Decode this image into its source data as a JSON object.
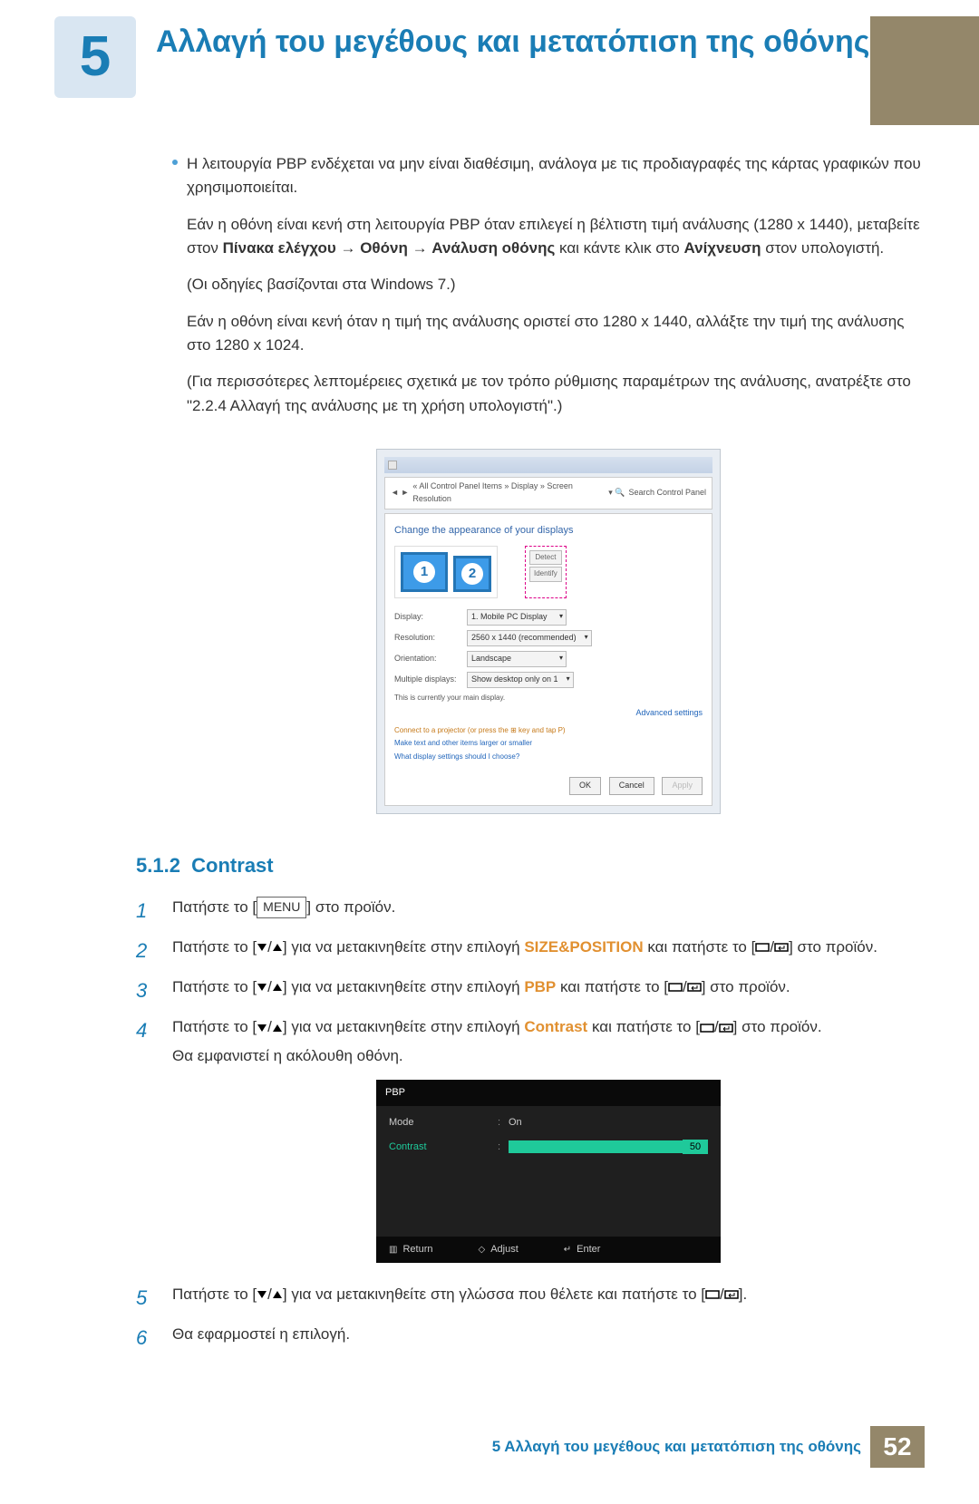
{
  "chapter": {
    "number": "5",
    "title": "Αλλαγή του μεγέθους και μετατόπιση της οθόνης"
  },
  "intro": {
    "bullet": "Η λειτουργία PBP ενδέχεται να μην είναι διαθέσιμη, ανάλογα με τις προδιαγραφές της κάρτας γραφικών που χρησιμοποιείται.",
    "p1_a": "Εάν η οθόνη είναι κενή στη λειτουργία PBP όταν επιλεγεί η βέλτιστη τιμή ανάλυσης (1280 x 1440), μεταβείτε στον ",
    "p1_b": "Πίνακα ελέγχου",
    "p1_c": "Οθόνη",
    "p1_d": "Ανάλυση οθόνης",
    "p1_e": " και κάντε κλικ στο ",
    "p1_f": "Ανίχνευση",
    "p1_g": " στον υπολογιστή.",
    "p2": "(Οι οδηγίες βασίζονται στα Windows 7.)",
    "p3": "Εάν η οθόνη είναι κενή όταν η τιμή της ανάλυσης οριστεί στο 1280 x 1440, αλλάξτε την τιμή της ανάλυσης στο 1280 x 1024.",
    "p4": "(Για περισσότερες λεπτομέρειες σχετικά με τον τρόπο ρύθμισης παραμέτρων της ανάλυσης, ανατρέξτε στο \"2.2.4   Αλλαγή της ανάλυσης με τη χρήση υπολογιστή\".)"
  },
  "screenshot": {
    "breadcrumb": "« All Control Panel Items » Display » Screen Resolution",
    "search_placeholder": "Search Control Panel",
    "heading": "Change the appearance of your displays",
    "btn_detect": "Detect",
    "btn_identify": "Identify",
    "field_display": "Display:",
    "val_display": "1. Mobile PC Display",
    "field_resolution": "Resolution:",
    "val_resolution": "2560 x 1440 (recommended)",
    "field_orientation": "Orientation:",
    "val_orientation": "Landscape",
    "field_multi": "Multiple displays:",
    "val_multi": "Show desktop only on 1",
    "note1": "This is currently your main display.",
    "adv": "Advanced settings",
    "link1": "Connect to a projector (or press the ⊞ key and tap P)",
    "link2": "Make text and other items larger or smaller",
    "link3": "What display settings should I choose?",
    "ok": "OK",
    "cancel": "Cancel",
    "apply": "Apply"
  },
  "section": {
    "num": "5.1.2",
    "title": "Contrast"
  },
  "steps": {
    "s1_a": "Πατήστε το [",
    "s1_menu": "MENU",
    "s1_b": "] στο προϊόν.",
    "s2_a": "Πατήστε το [",
    "s2_b": "] για να μετακινηθείτε στην επιλογή ",
    "s2_opt": "SIZE&POSITION",
    "s2_c": " και πατήστε το [",
    "s2_d": "] στο προϊόν.",
    "s3_a": "Πατήστε το [",
    "s3_b": "] για να μετακινηθείτε στην επιλογή ",
    "s3_opt": "PBP",
    "s3_c": " και πατήστε το [",
    "s3_d": "] στο προϊόν.",
    "s4_a": "Πατήστε το [",
    "s4_b": "] για να μετακινηθείτε στην επιλογή ",
    "s4_opt": "Contrast",
    "s4_c": " και πατήστε το [",
    "s4_d": "] στο προϊόν.",
    "s4_e": "Θα εμφανιστεί η ακόλουθη οθόνη.",
    "s5_a": "Πατήστε το [",
    "s5_b": "] για να μετακινηθείτε στη γλώσσα που θέλετε και πατήστε το [",
    "s5_c": "].",
    "s6": "Θα εφαρμοστεί η επιλογή."
  },
  "osd": {
    "title": "PBP",
    "mode": "Mode",
    "mode_val": "On",
    "contrast": "Contrast",
    "contrast_val": "50",
    "return": "Return",
    "adjust": "Adjust",
    "enter": "Enter"
  },
  "footer": {
    "text": "5 Αλλαγή του μεγέθους και μετατόπιση της οθόνης",
    "page": "52"
  }
}
